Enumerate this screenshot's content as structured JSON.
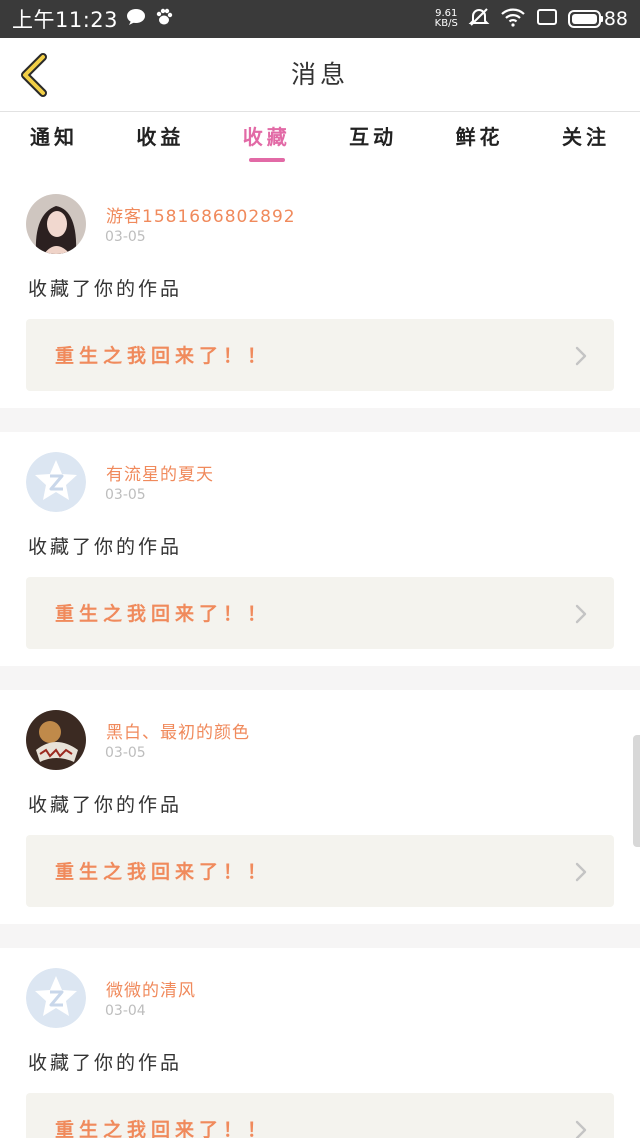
{
  "status_bar": {
    "time": "上午11:23",
    "net_speed_value": "9.61",
    "net_speed_unit": "KB/S",
    "battery": "88"
  },
  "header": {
    "title": "消息"
  },
  "tabs": [
    {
      "label": "通知"
    },
    {
      "label": "收益"
    },
    {
      "label": "收藏"
    },
    {
      "label": "互动"
    },
    {
      "label": "鲜花"
    },
    {
      "label": "关注"
    }
  ],
  "active_tab": "收藏",
  "colors": {
    "accent": "#e26aa6",
    "name_orange": "#f08a5c",
    "card_bg": "#f4f3ee"
  },
  "items": [
    {
      "user": "游客1581686802892",
      "date": "03-05",
      "action": "收藏了你的作品",
      "work": "重生之我回来了！！",
      "avatar": "photo-avatar"
    },
    {
      "user": "有流星的夏天",
      "date": "03-05",
      "action": "收藏了你的作品",
      "work": "重生之我回来了！！",
      "avatar": "default-avatar"
    },
    {
      "user": "黑白、最初的颜色",
      "date": "03-05",
      "action": "收藏了你的作品",
      "work": "重生之我回来了！！",
      "avatar": "photo-avatar"
    },
    {
      "user": "微微的清风",
      "date": "03-04",
      "action": "收藏了你的作品",
      "work": "重生之我回来了！！",
      "avatar": "default-avatar"
    }
  ]
}
